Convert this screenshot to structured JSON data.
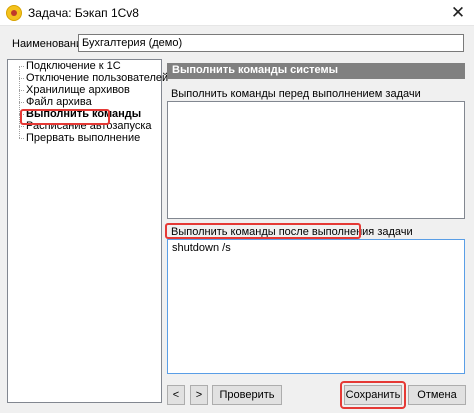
{
  "window": {
    "title": "Задача: Бэкап 1Cv8",
    "close_glyph": "✕"
  },
  "name_field": {
    "label": "Наименование:",
    "value": "Бухгалтерия (демо)"
  },
  "tree": {
    "items": [
      {
        "label": "Подключение к 1С"
      },
      {
        "label": "Отключение пользователей"
      },
      {
        "label": "Хранилище архивов"
      },
      {
        "label": "Файл архива"
      },
      {
        "label": "Выполнить команды",
        "selected": true
      },
      {
        "label": "Расписание автозапуска"
      },
      {
        "label": "Прервать выполнение"
      }
    ]
  },
  "panel": {
    "header": "Выполнить команды системы",
    "before_label": "Выполнить команды перед выполнением задачи",
    "before_value": "",
    "after_label": "Выполнить команды после выполнения задачи",
    "after_value": "shutdown /s"
  },
  "buttons": {
    "prev": "<",
    "next": ">",
    "check": "Проверить",
    "save": "Сохранить",
    "cancel": "Отмена"
  },
  "colors": {
    "highlight": "#e53935",
    "header_bg": "#808080",
    "focus_border": "#5a9ee6"
  }
}
